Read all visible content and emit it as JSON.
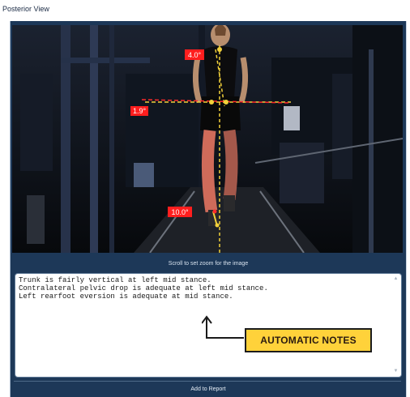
{
  "window": {
    "title": "Posterior View"
  },
  "image_view": {
    "angles": {
      "trunk": "4.0°",
      "pelvis": "1.9°",
      "rearfoot": "10.0°"
    },
    "zoom_hint": "Scroll to set zoom for the image"
  },
  "notes": {
    "text": "Trunk is fairly vertical at left mid stance.\nContralateral pelvic drop is adequate at left mid stance.\nLeft rearfoot eversion is adequate at mid stance."
  },
  "annotation": {
    "label": "AUTOMATIC NOTES"
  },
  "actions": {
    "add_to_report": "Add to Report"
  },
  "colors": {
    "frame": "#1d3858",
    "angle_label_bg": "#ff1e1e",
    "pelvis_line": "#ff2a2a",
    "trunk_line": "#f2d13a",
    "annotation_bg": "#ffd23a"
  }
}
